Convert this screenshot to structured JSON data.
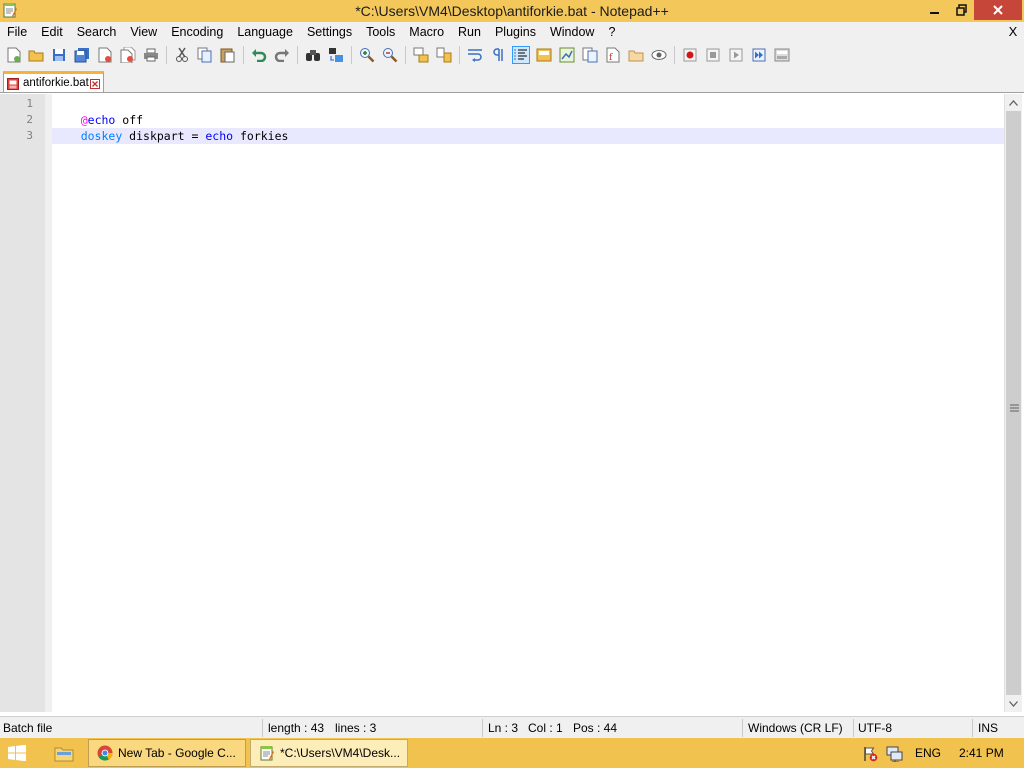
{
  "window": {
    "title": "*C:\\Users\\VM4\\Desktop\\antiforkie.bat - Notepad++",
    "menu_close": "X"
  },
  "menu": [
    "File",
    "Edit",
    "Search",
    "View",
    "Encoding",
    "Language",
    "Settings",
    "Tools",
    "Macro",
    "Run",
    "Plugins",
    "Window",
    "?"
  ],
  "toolbar": {
    "icons": [
      "new-file-icon",
      "open-file-icon",
      "save-icon",
      "save-all-icon",
      "close-icon",
      "close-all-icon",
      "print-icon",
      "cut-icon",
      "copy-icon",
      "paste-icon",
      "undo-icon",
      "redo-icon",
      "find-icon",
      "replace-icon",
      "zoom-in-icon",
      "zoom-out-icon",
      "sync-vertical-icon",
      "sync-horizontal-icon",
      "word-wrap-icon",
      "show-all-chars-icon",
      "indent-guide-icon",
      "user-defined-lang-icon",
      "doc-map-icon",
      "function-list-icon",
      "folder-workspace-icon",
      "monitoring-icon",
      "record-macro-icon",
      "stop-record-icon",
      "play-macro-icon",
      "run-macro-multiple-icon",
      "save-macro-icon"
    ]
  },
  "tabs": [
    {
      "label": "antiforkie.bat",
      "modified": true
    }
  ],
  "editor": {
    "line_numbers": [
      "1",
      "2",
      "3"
    ],
    "lines": [
      [
        {
          "t": "@",
          "c": "at"
        },
        {
          "t": "echo",
          "c": "kw"
        },
        {
          "t": " off",
          "c": "txt"
        }
      ],
      [
        {
          "t": "doskey",
          "c": "cmd"
        },
        {
          "t": " diskpart = ",
          "c": "txt"
        },
        {
          "t": "echo",
          "c": "kw"
        },
        {
          "t": " forkies",
          "c": "txt"
        }
      ],
      []
    ]
  },
  "statusbar": {
    "language": "Batch file",
    "length": "length : 43",
    "lines": "lines : 3",
    "ln": "Ln : 3",
    "col": "Col : 1",
    "pos": "Pos : 44",
    "eol": "Windows (CR LF)",
    "encoding": "UTF-8",
    "mode": "INS"
  },
  "taskbar": {
    "items": [
      {
        "label": "New Tab - Google C..."
      },
      {
        "label": "*C:\\Users\\VM4\\Desk..."
      }
    ],
    "lang": "ENG",
    "clock": "2:41 PM"
  },
  "colors": {
    "title_bar": "#f3c75a",
    "taskbar": "#f1c24e",
    "close_button": "#c7463a",
    "tab_accent": "#f7b23a",
    "current_line": "#e8e8ff"
  }
}
